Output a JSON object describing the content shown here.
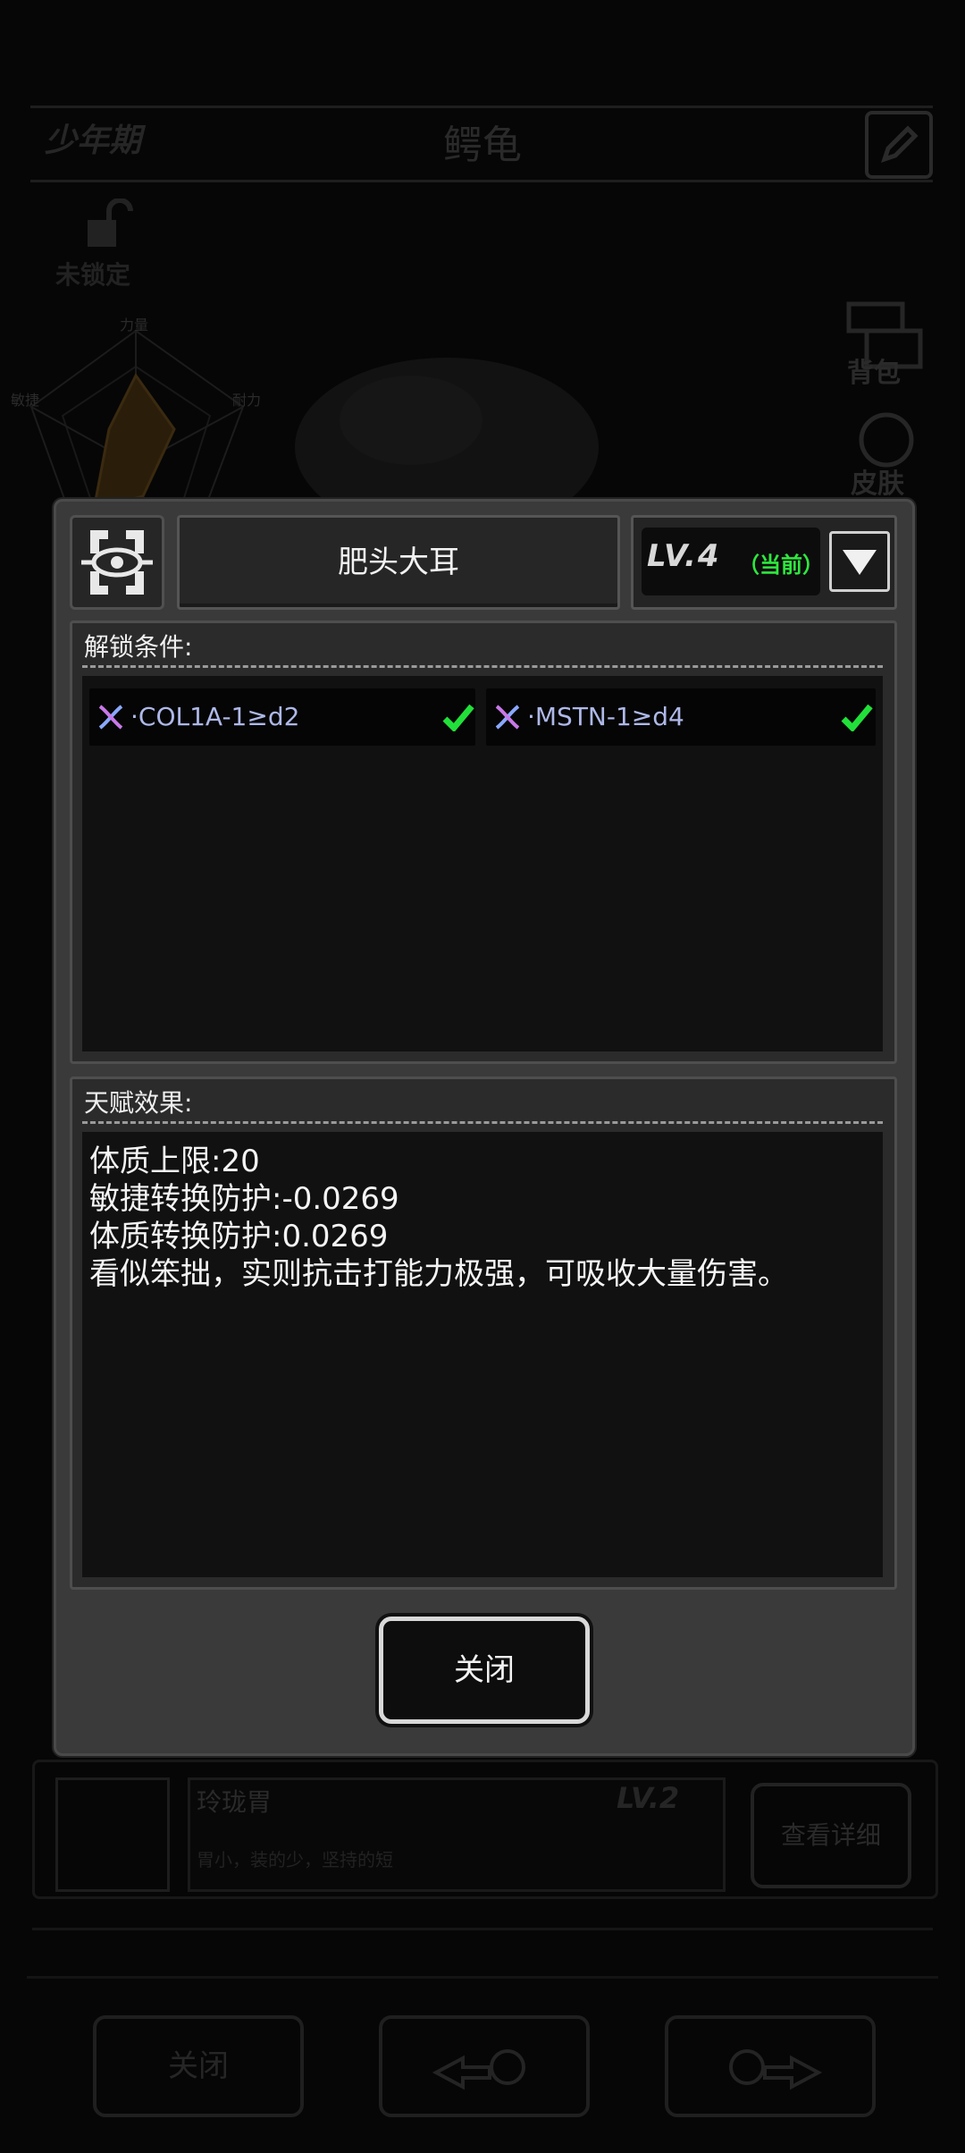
{
  "background": {
    "growth_stage": "少年期",
    "creature_name": "鳄龟",
    "lock_status": "未锁定",
    "radar_labels": [
      "力量",
      "敏捷",
      "耐力"
    ],
    "side_buttons": [
      "背包",
      "皮肤"
    ],
    "trait_row": {
      "title": "玲珑胃",
      "level": "LV.2",
      "description": "胃小，装的少，坚持的短",
      "detail_button": "查看详细"
    },
    "bottom_close": "关闭"
  },
  "dialog": {
    "trait_name": "肥头大耳",
    "level": "LV.4",
    "level_status": "（当前）",
    "unlock_header": "解锁条件:",
    "unlock_conditions": [
      {
        "text": "·COL1A-1≥d2",
        "met": true,
        "icon": "dna-icon"
      },
      {
        "text": "·MSTN-1≥d4",
        "met": true,
        "icon": "dna-icon"
      }
    ],
    "effect_header": "天赋效果:",
    "effects": [
      "体质上限:20",
      "敏捷转换防护:-0.0269",
      "体质转换防护:0.0269",
      "看似笨拙，实则抗击打能力极强，可吸收大量伤害。"
    ],
    "close_label": "关闭"
  },
  "colors": {
    "accent_green": "#2ee83e",
    "condition_text": "#aeb8e8",
    "dialog_bg": "#3a3a3a"
  }
}
